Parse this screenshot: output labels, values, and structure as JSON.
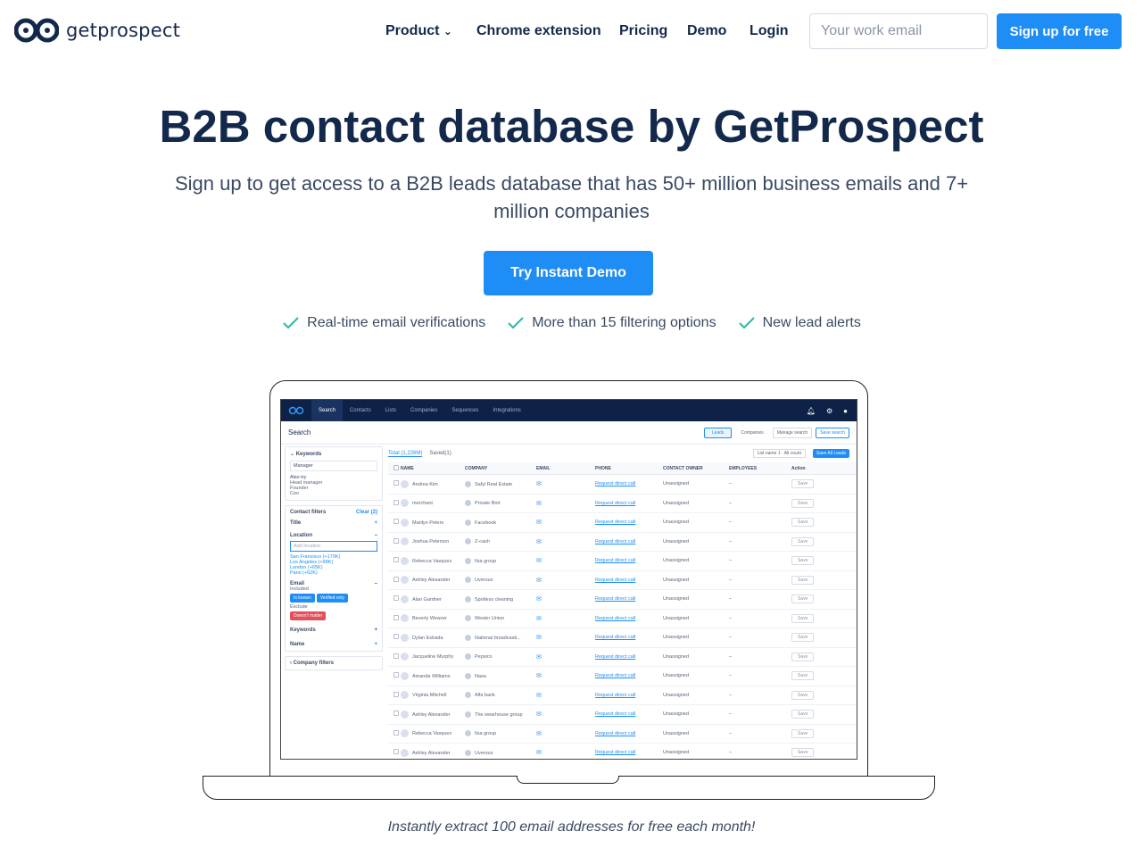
{
  "nav": {
    "logo_text": "getprospect",
    "links": [
      "Product",
      "Chrome extension",
      "Pricing",
      "Demo",
      "Login"
    ],
    "email_placeholder": "Your work email",
    "signup_label": "Sign up for free"
  },
  "hero": {
    "title": "B2B contact database by GetProspect",
    "subtitle": "Sign up to get access to a B2B leads database that has 50+ million business emails and 7+ million companies",
    "cta_label": "Try Instant Demo",
    "features": [
      "Real-time email verifications",
      "More than 15 filtering options",
      "New lead alerts"
    ]
  },
  "caption": "Instantly extract 100 email addresses for free each month!",
  "app": {
    "tabs": [
      "Search",
      "Contacts",
      "Lists",
      "Companies",
      "Sequences",
      "Integrations"
    ],
    "search_title": "Search",
    "toggle": [
      "Leads",
      "Companies"
    ],
    "manage_search": "Manage search",
    "save_search": "Save search",
    "total_tab": "Total (1,226M)",
    "saved_tab": "Saved(1)",
    "list_select": "List name 1",
    "all_count": "All count",
    "save_all": "Save All Leads",
    "filters": {
      "keywords_title": "Keywords",
      "keywords_value": "Manager",
      "also_try_label": "Also try",
      "also_try": [
        "Head manager",
        "Founder",
        "Ceo"
      ],
      "contact_filters": "Contact filters",
      "clear": "Clear (2)",
      "title": "Title",
      "location": "Location",
      "location_placeholder": "Add location",
      "locations": [
        "San Francisco (+170K)",
        "Los Angeles (+98K)",
        "London (+65K)",
        "Paris (+62K)"
      ],
      "email": "Email",
      "included": "Included",
      "included_tags": [
        "Is known",
        "Verified only"
      ],
      "exclude": "Exclude",
      "exclude_tag": "Doesn't matter",
      "keywords2": "Keywords",
      "name": "Name",
      "company_filters": "Company filters"
    },
    "columns": [
      "NAME",
      "COMPANY",
      "EMAIL",
      "PHONE",
      "CONTACT OWNER",
      "EMPLOYEES",
      "Action"
    ],
    "phone_link": "Request direct call",
    "owner": "Unassigned",
    "employees": "–",
    "save_label": "Save",
    "rows": [
      {
        "name": "Andrea Kim",
        "company": "Safyi Real Estate"
      },
      {
        "name": "merchant",
        "company": "Private Bird"
      },
      {
        "name": "Marilyn Peters",
        "company": "Facebook"
      },
      {
        "name": "Joshua Peterson",
        "company": "Z-cash"
      },
      {
        "name": "Rebecca Vasquez",
        "company": "Ilsa group"
      },
      {
        "name": "Ashley Alexander",
        "company": "Uverous"
      },
      {
        "name": "Alan Gardner",
        "company": "Spotless cleaning"
      },
      {
        "name": "Beverly Weaver",
        "company": "Wester Union"
      },
      {
        "name": "Dylan Estrada",
        "company": "National broadcasti..."
      },
      {
        "name": "Jacqueline Murphy",
        "company": "Pepsico"
      },
      {
        "name": "Amanda Williams",
        "company": "Nasa"
      },
      {
        "name": "Virginia Mitchell",
        "company": "Alfa bank"
      },
      {
        "name": "Ashley Alexander",
        "company": "The wearhouse group"
      },
      {
        "name": "Rebecca Vasquez",
        "company": "Ilsa group"
      },
      {
        "name": "Ashley Alexander",
        "company": "Uverous"
      }
    ]
  }
}
